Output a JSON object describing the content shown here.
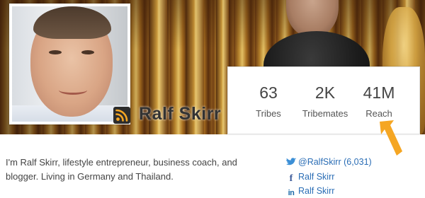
{
  "profile": {
    "name": "Ralf Skirr",
    "bio": "I'm Ralf Skirr, lifestyle entrepreneur, business coach, and blogger. Living in Germany and Thailand."
  },
  "stats": [
    {
      "value": "63",
      "label": "Tribes"
    },
    {
      "value": "2K",
      "label": "Tribemates"
    },
    {
      "value": "41M",
      "label": "Reach"
    }
  ],
  "social": {
    "twitter": "@RalfSkirr (6,031)",
    "facebook": "Ralf Skirr",
    "linkedin": "Ralf Skirr"
  },
  "icons": {
    "feed": "rss-feed-icon",
    "twitter": "twitter-icon",
    "facebook": "facebook-icon",
    "linkedin": "linkedin-icon",
    "annotation": "orange-arrow-icon"
  },
  "colors": {
    "arrow": "#f5a623",
    "link": "#2a6db5",
    "feed_icon_bg": "#2c2c2c",
    "feed_icon_fg": "#f5a623"
  }
}
